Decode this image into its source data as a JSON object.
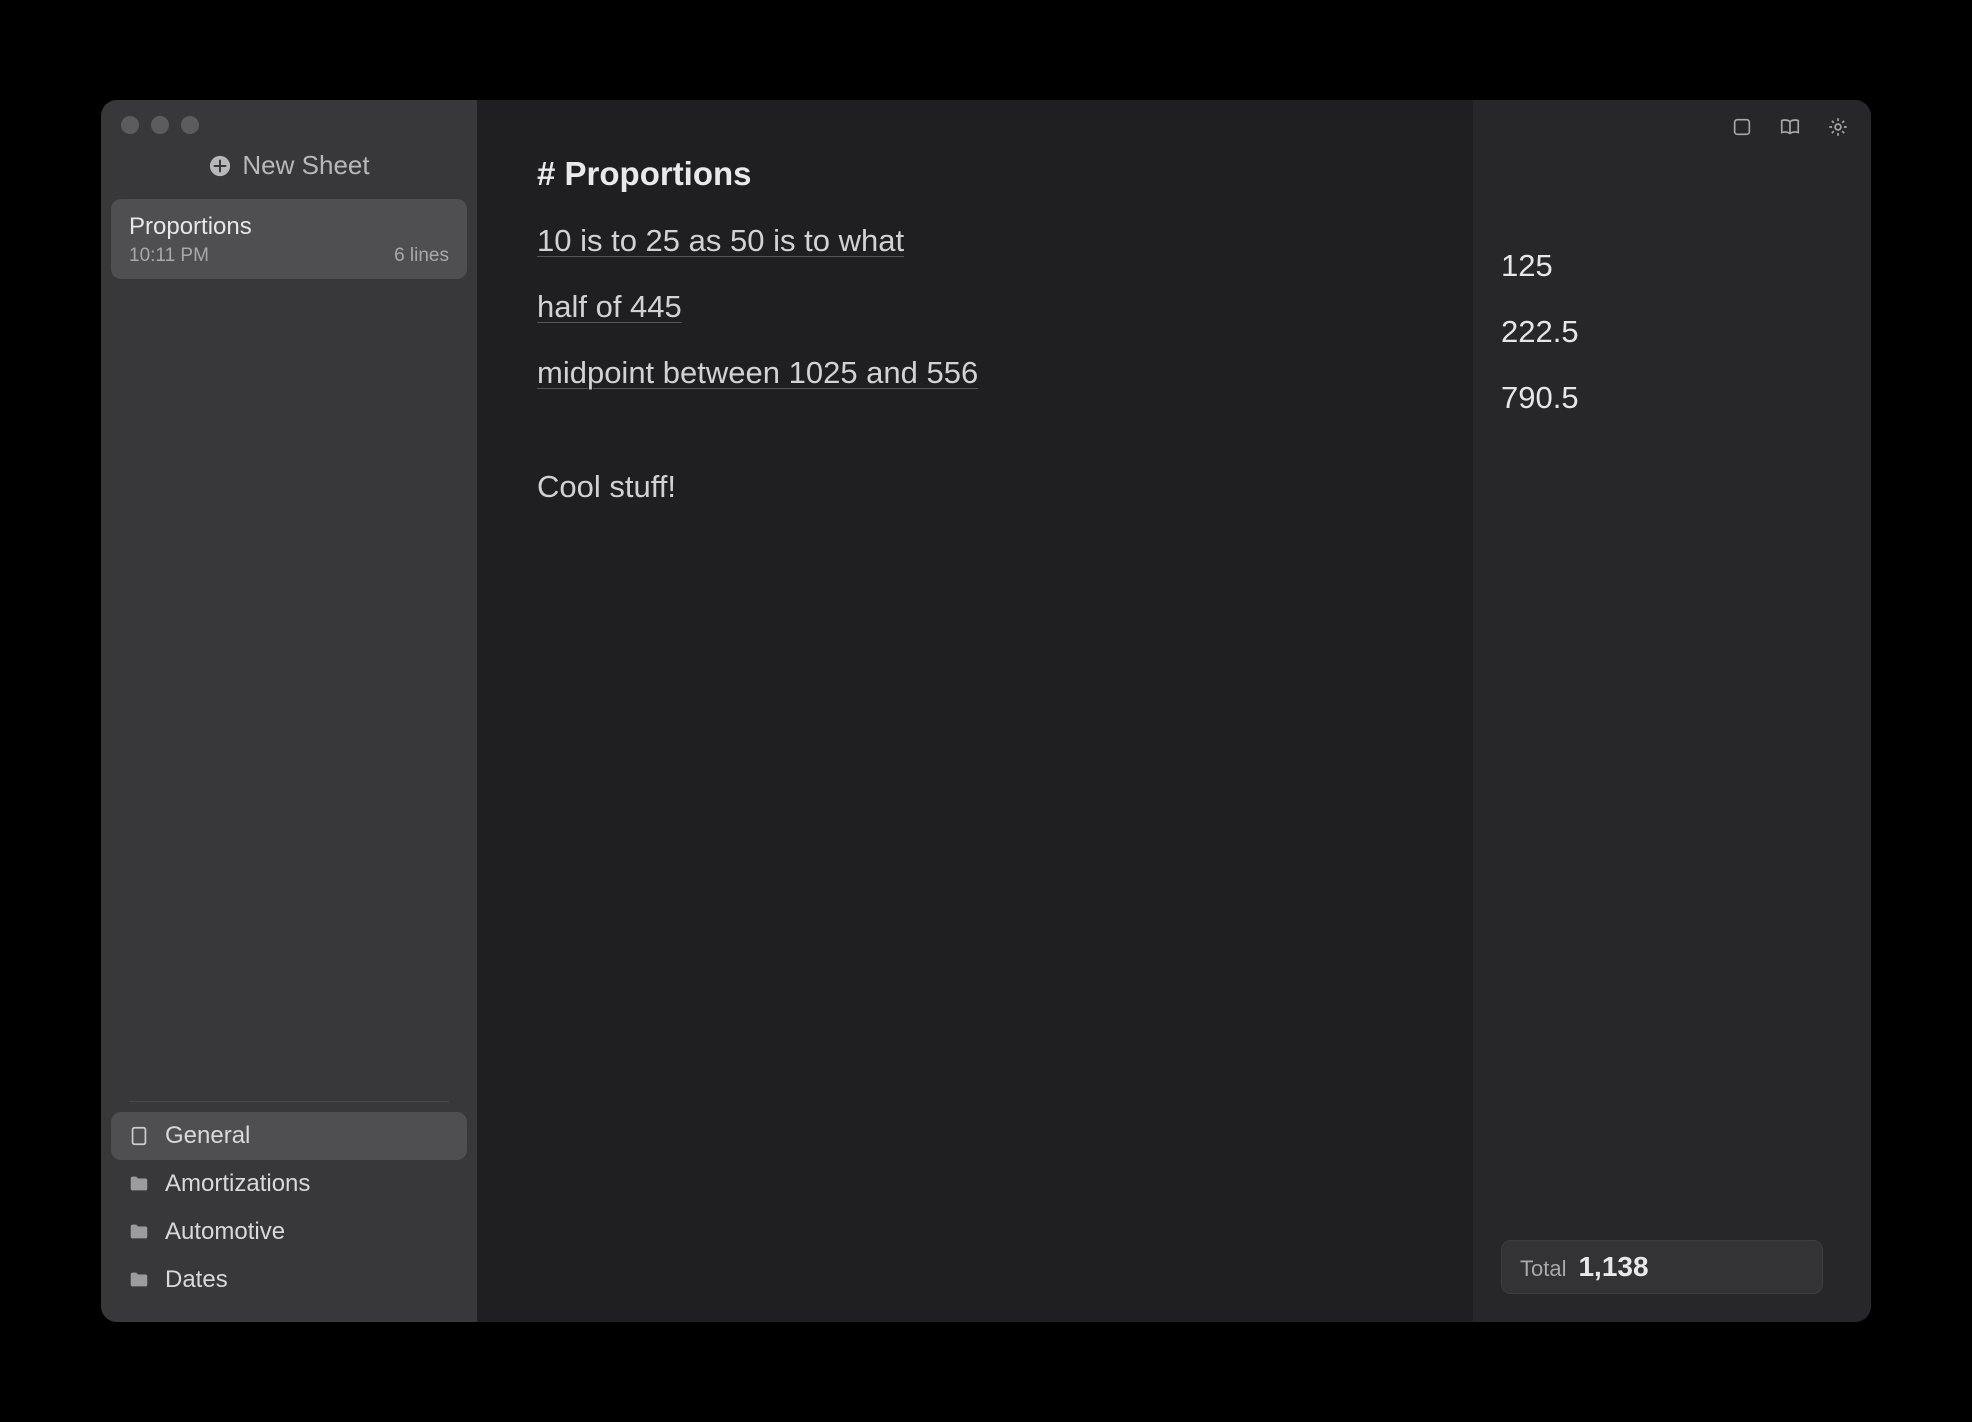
{
  "sidebar": {
    "new_sheet_label": "New Sheet",
    "sheets": [
      {
        "title": "Proportions",
        "time": "10:11 PM",
        "meta": "6 lines"
      }
    ],
    "tags": [
      {
        "label": "General",
        "selected": true,
        "icon": "sheet"
      },
      {
        "label": "Amortizations",
        "selected": false,
        "icon": "folder"
      },
      {
        "label": "Automotive",
        "selected": false,
        "icon": "folder"
      },
      {
        "label": "Dates",
        "selected": false,
        "icon": "folder"
      }
    ]
  },
  "editor": {
    "heading": "# Proportions",
    "lines": [
      {
        "text": "10 is to 25 as 50 is to what",
        "type": "expr"
      },
      {
        "text": "half of 445",
        "type": "expr"
      },
      {
        "text": "midpoint between 1025 and 556",
        "type": "expr"
      },
      {
        "text": "",
        "type": "blank"
      },
      {
        "text": "Cool stuff!",
        "type": "text"
      }
    ]
  },
  "results": {
    "values": [
      "125",
      "222.5",
      "790.5"
    ],
    "total_label": "Total",
    "total_value": "1,138"
  }
}
